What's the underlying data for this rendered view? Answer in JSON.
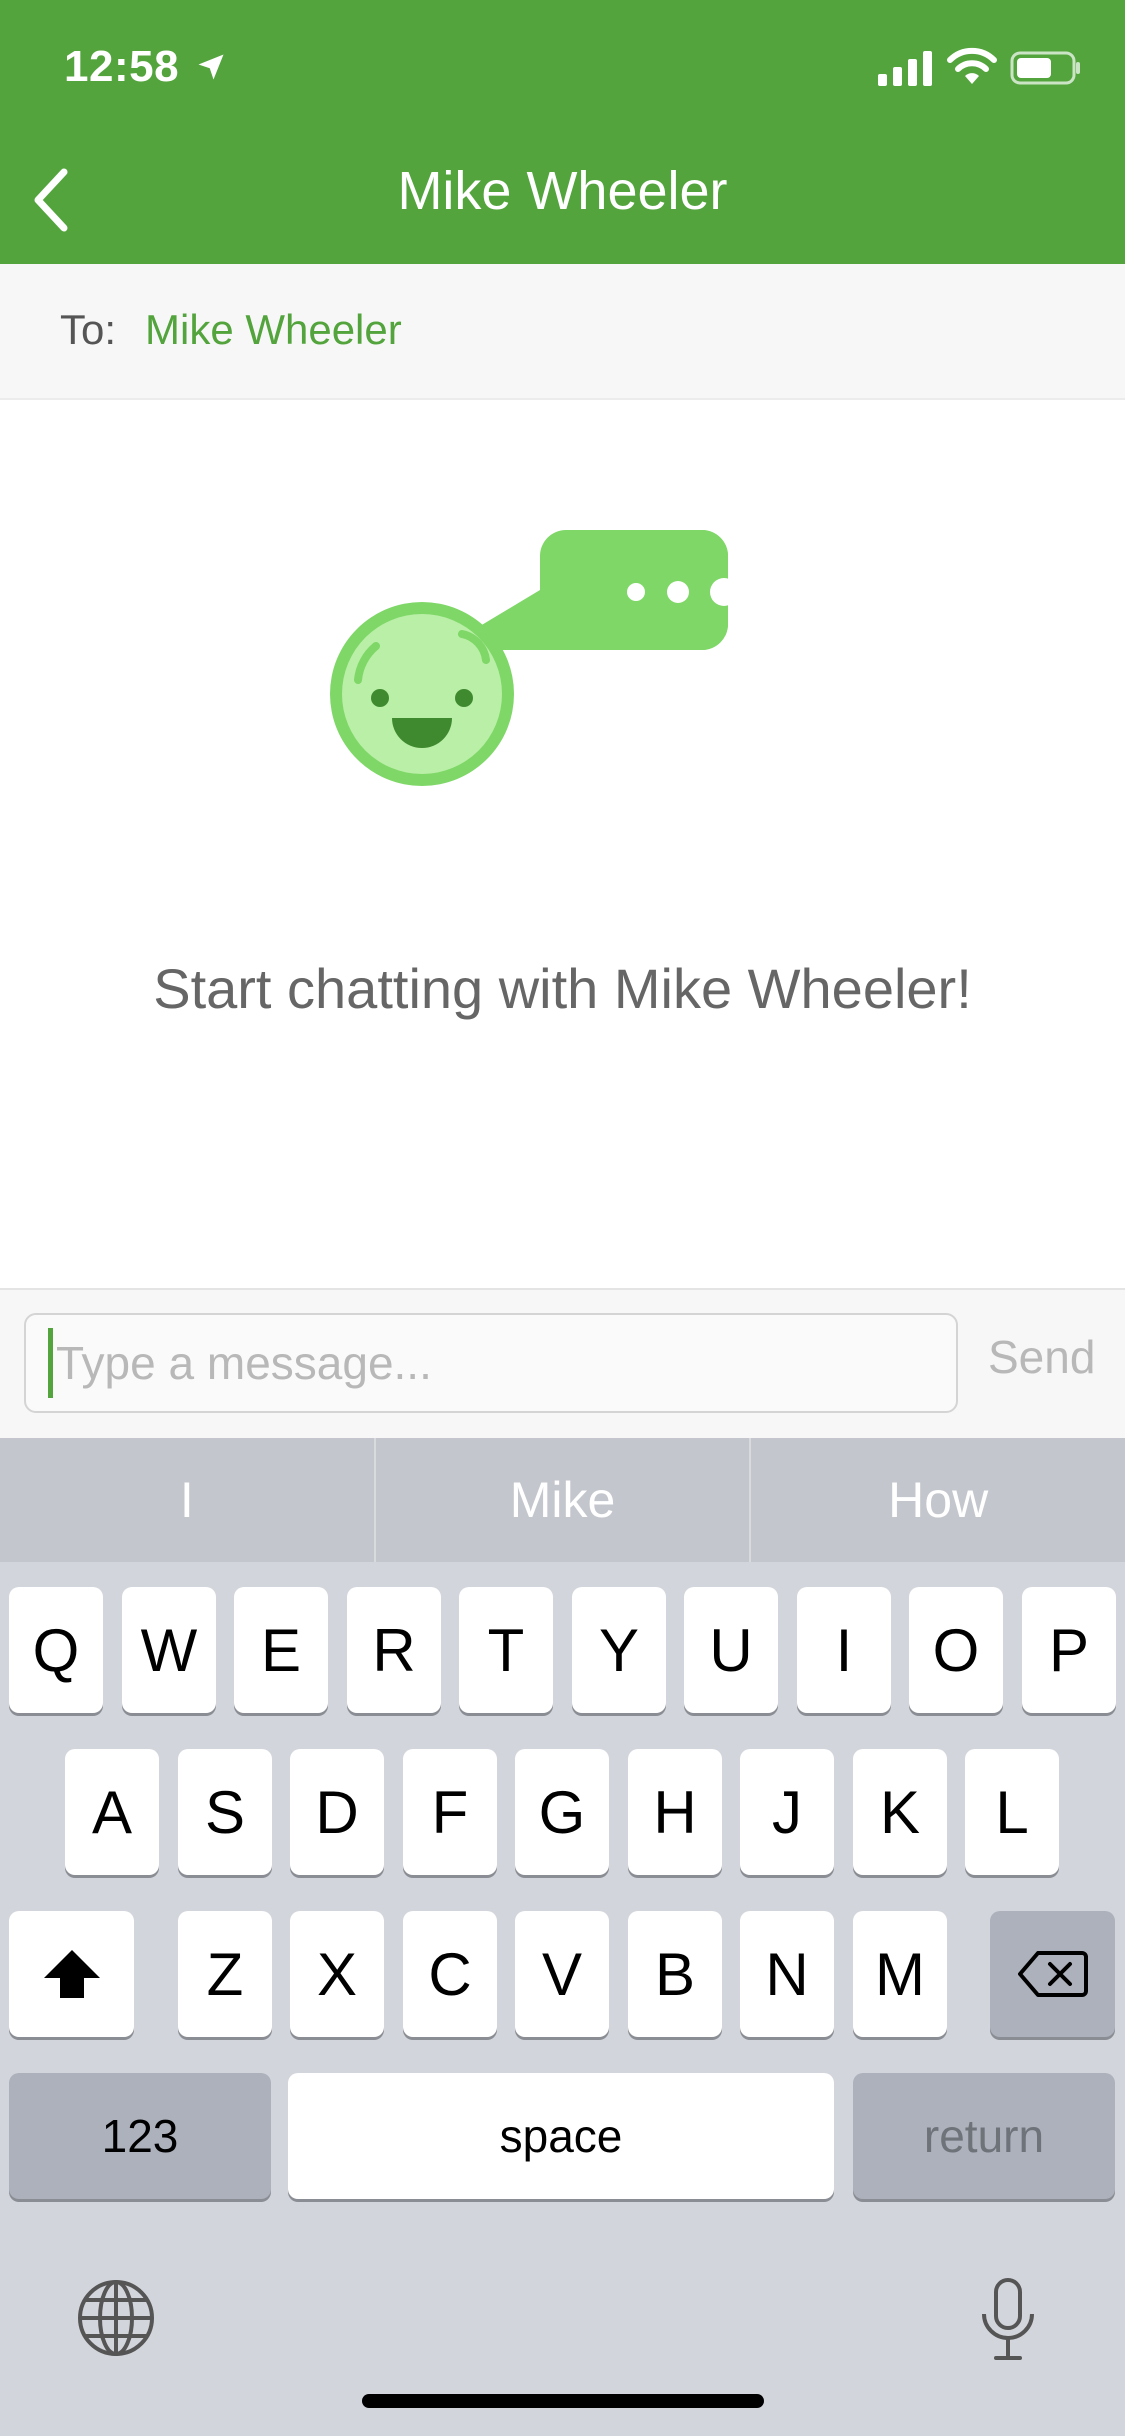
{
  "status_bar": {
    "time": "12:58",
    "icons": [
      "location-arrow-icon",
      "cellular-signal-icon",
      "wifi-icon",
      "battery-icon"
    ]
  },
  "nav": {
    "title": "Mike Wheeler",
    "back_icon": "chevron-left-icon"
  },
  "recipient": {
    "label": "To:",
    "name": "Mike Wheeler"
  },
  "empty_state": {
    "icons": [
      "smiley-face-icon",
      "chat-bubble-icon"
    ],
    "message": "Start chatting with Mike Wheeler!"
  },
  "composer": {
    "placeholder": "Type a message...",
    "value": "",
    "send_label": "Send"
  },
  "keyboard": {
    "suggestions": [
      "I",
      "Mike",
      "How"
    ],
    "row1": [
      "Q",
      "W",
      "E",
      "R",
      "T",
      "Y",
      "U",
      "I",
      "O",
      "P"
    ],
    "row2": [
      "A",
      "S",
      "D",
      "F",
      "G",
      "H",
      "J",
      "K",
      "L"
    ],
    "row3": [
      "Z",
      "X",
      "C",
      "V",
      "B",
      "N",
      "M"
    ],
    "numbers_label": "123",
    "space_label": "space",
    "return_label": "return",
    "icons": [
      "shift-icon",
      "delete-icon",
      "globe-icon",
      "microphone-icon"
    ]
  },
  "colors": {
    "brand_green": "#53a43d",
    "illustration_green": "#7ed767",
    "keyboard_bg": "#d2d5db"
  }
}
